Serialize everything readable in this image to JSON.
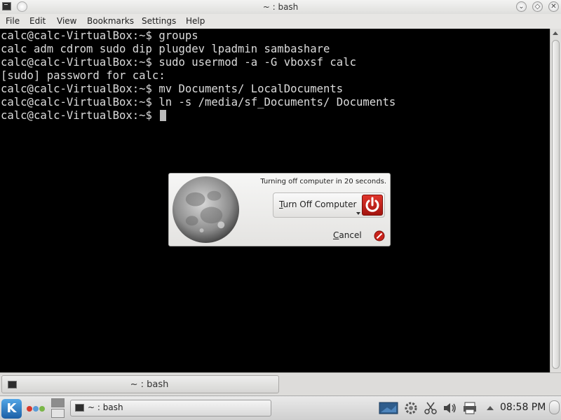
{
  "window": {
    "title": "~ : bash",
    "buttons": {
      "minimize": "⌄",
      "maximize": "◇",
      "close": "✕"
    }
  },
  "menu": [
    "File",
    "Edit",
    "View",
    "Bookmarks",
    "Settings",
    "Help"
  ],
  "terminal": {
    "lines": [
      "calc@calc-VirtualBox:~$ groups",
      "calc adm cdrom sudo dip plugdev lpadmin sambashare",
      "calc@calc-VirtualBox:~$ sudo usermod -a -G vboxsf calc",
      "[sudo] password for calc:",
      "calc@calc-VirtualBox:~$ mv Documents/ LocalDocuments",
      "calc@calc-VirtualBox:~$ ln -s /media/sf_Documents/ Documents",
      "calc@calc-VirtualBox:~$ "
    ]
  },
  "tabbar": {
    "tab_label": "~ : bash"
  },
  "dialog": {
    "message": "Turning off computer in 20 seconds.",
    "turnoff_accel": "T",
    "turnoff_rest": "urn Off Computer",
    "cancel_accel": "C",
    "cancel_rest": "ancel"
  },
  "taskbar": {
    "start_glyph": "K",
    "task_label": "~ : bash",
    "clock": "08:58 PM",
    "tray_icons": [
      "desktop-icon",
      "network-settings-icon",
      "klipper-scissors-icon",
      "volume-icon",
      "printer-icon",
      "expand-arrow-icon"
    ]
  },
  "colors": {
    "terminal_bg": "#000000",
    "terminal_fg": "#dcdcdc",
    "power_red": "#c4201a",
    "kde_blue": "#2a7fd4"
  }
}
